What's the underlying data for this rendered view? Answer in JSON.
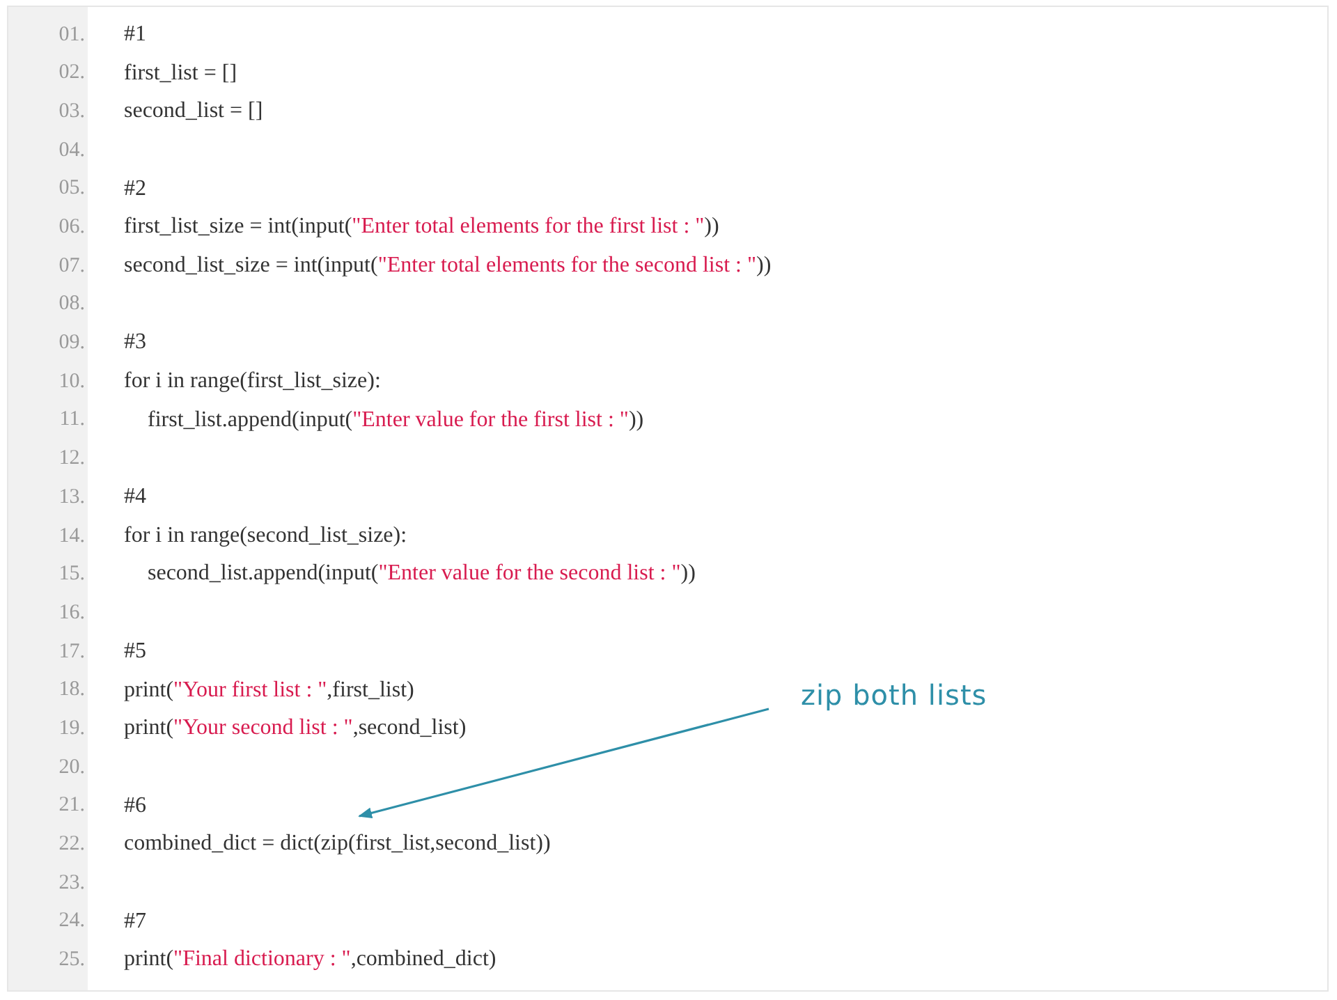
{
  "code_lines": [
    {
      "number": "01.",
      "segments": [
        {
          "kind": "code",
          "text": "#1"
        }
      ]
    },
    {
      "number": "02.",
      "segments": [
        {
          "kind": "code",
          "text": "first_list = []"
        }
      ]
    },
    {
      "number": "03.",
      "segments": [
        {
          "kind": "code",
          "text": "second_list = []"
        }
      ]
    },
    {
      "number": "04."
    },
    {
      "number": "05.",
      "segments": [
        {
          "kind": "code",
          "text": "#2"
        }
      ]
    },
    {
      "number": "06.",
      "segments": [
        {
          "kind": "code",
          "text": "first_list_size = int(input("
        },
        {
          "kind": "string",
          "text": "\"Enter total elements for the first list : \""
        },
        {
          "kind": "code",
          "text": "))"
        }
      ]
    },
    {
      "number": "07.",
      "segments": [
        {
          "kind": "code",
          "text": "second_list_size = int(input("
        },
        {
          "kind": "string",
          "text": "\"Enter total elements for the second list : \""
        },
        {
          "kind": "code",
          "text": "))"
        }
      ]
    },
    {
      "number": "08."
    },
    {
      "number": "09.",
      "segments": [
        {
          "kind": "code",
          "text": "#3"
        }
      ]
    },
    {
      "number": "10.",
      "segments": [
        {
          "kind": "code",
          "text": "for i in range(first_list_size):"
        }
      ],
      "children": [
        {
          "number": "11.",
          "segments": [
            {
              "kind": "code",
              "text": "first_list.append(input("
            },
            {
              "kind": "string",
              "text": "\"Enter value for the first list : \""
            },
            {
              "kind": "code",
              "text": "))"
            }
          ]
        }
      ]
    },
    {
      "number": "12."
    },
    {
      "number": "13.",
      "segments": [
        {
          "kind": "code",
          "text": "#4"
        }
      ]
    },
    {
      "number": "14.",
      "segments": [
        {
          "kind": "code",
          "text": "for i in range(second_list_size):"
        }
      ],
      "children": [
        {
          "number": "15.",
          "segments": [
            {
              "kind": "code",
              "text": "second_list.append(input("
            },
            {
              "kind": "string",
              "text": "\"Enter value for the second list : \""
            },
            {
              "kind": "code",
              "text": "))"
            }
          ]
        }
      ]
    },
    {
      "number": "16."
    },
    {
      "number": "17.",
      "segments": [
        {
          "kind": "code",
          "text": "#5"
        }
      ]
    },
    {
      "number": "18.",
      "segments": [
        {
          "kind": "code",
          "text": "print("
        },
        {
          "kind": "string",
          "text": "\"Your first list : \""
        },
        {
          "kind": "code",
          "text": ",first_list)"
        }
      ]
    },
    {
      "number": "19.",
      "segments": [
        {
          "kind": "code",
          "text": "print("
        },
        {
          "kind": "string",
          "text": "\"Your second list : \""
        },
        {
          "kind": "code",
          "text": ",second_list)"
        }
      ]
    },
    {
      "number": "20."
    },
    {
      "number": "21.",
      "segments": [
        {
          "kind": "code",
          "text": "#6"
        }
      ]
    },
    {
      "number": "22.",
      "segments": [
        {
          "kind": "code",
          "text": "combined_dict = dict(zip(first_list,second_list))"
        }
      ]
    },
    {
      "number": "23."
    },
    {
      "number": "24.",
      "segments": [
        {
          "kind": "code",
          "text": "#7"
        }
      ]
    },
    {
      "number": "25.",
      "segments": [
        {
          "kind": "code",
          "text": "print("
        },
        {
          "kind": "string",
          "text": "\"Final dictionary : \""
        },
        {
          "kind": "code",
          "text": ",combined_dict)"
        }
      ]
    }
  ],
  "annotation": {
    "text": "zip both lists"
  }
}
